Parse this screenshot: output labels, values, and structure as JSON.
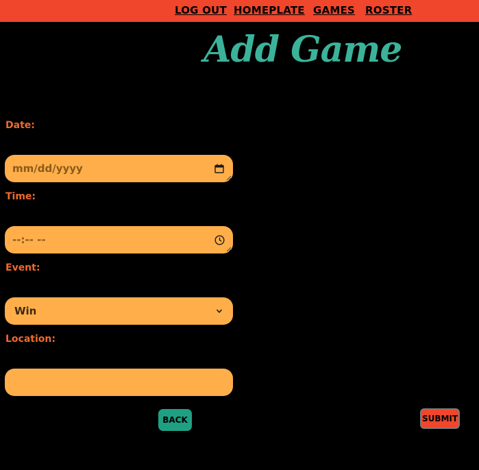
{
  "nav": {
    "logout": "LOG OUT",
    "homeplate": "HOMEPLATE",
    "games": "GAMES",
    "roster": "ROSTER"
  },
  "page": {
    "title": "Add Game"
  },
  "form": {
    "date": {
      "label": "Date:",
      "placeholder": "mm/dd/yyyy",
      "icon": "calendar-icon"
    },
    "time": {
      "label": "Time:",
      "placeholder": "--:-- --",
      "icon": "clock-icon"
    },
    "event": {
      "label": "Event:",
      "selected": "Win",
      "icon": "chevron-down-icon"
    },
    "location": {
      "label": "Location:",
      "value": ""
    }
  },
  "buttons": {
    "back": "BACK",
    "submit": "SUBMIT"
  },
  "colors": {
    "topbar": "#ef462c",
    "title": "#3bb39a",
    "label": "#ef6a2c",
    "field": "#ffae4a",
    "back_button": "#1fa083",
    "submit_button": "#ef462c",
    "background": "#000000"
  }
}
